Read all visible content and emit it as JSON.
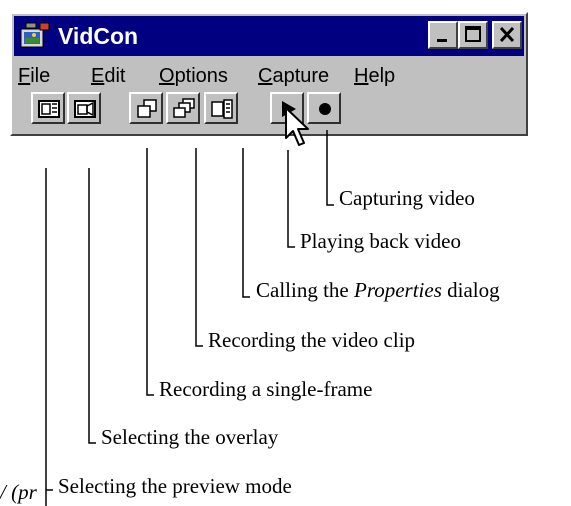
{
  "window": {
    "title": "VidCon",
    "controls": {
      "minimize": "_",
      "maximize": "□",
      "close": "✕"
    }
  },
  "menu": {
    "items": [
      {
        "label_underline": "F",
        "label_rest": "ile"
      },
      {
        "label_underline": "E",
        "label_rest": "dit"
      },
      {
        "label_underline": "O",
        "label_rest": "ptions"
      },
      {
        "label_underline": "C",
        "label_rest": "apture"
      },
      {
        "label_underline": "H",
        "label_rest": "elp"
      }
    ]
  },
  "toolbar": {
    "buttons": [
      {
        "icon": "preview-mode-icon"
      },
      {
        "icon": "overlay-icon"
      },
      {
        "icon": "single-frame-icon"
      },
      {
        "icon": "video-clip-icon"
      },
      {
        "icon": "properties-icon"
      },
      {
        "icon": "play-icon"
      },
      {
        "icon": "record-icon"
      }
    ]
  },
  "callouts": {
    "capture": "Capturing video",
    "play": "Playing back video",
    "properties_pre": "Calling the ",
    "properties_em": "Properties",
    "properties_post": " dialog",
    "clip": "Recording the video clip",
    "frame": "Recording a single-frame",
    "overlay": "Selecting the overlay",
    "preview": "Selecting the preview mode"
  },
  "fragment": "/ (pr"
}
